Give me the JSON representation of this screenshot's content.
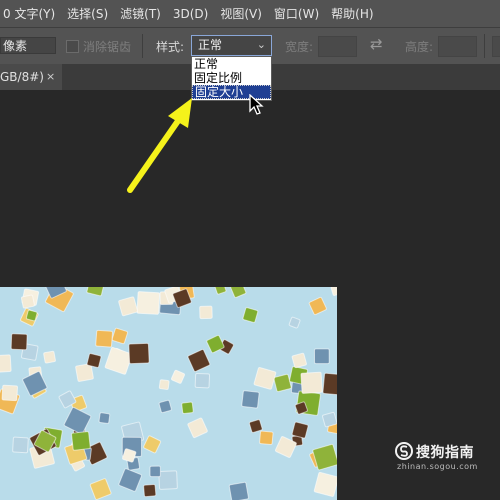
{
  "menubar": {
    "items": [
      "0 文字(Y)",
      "选择(S)",
      "滤镜(T)",
      "3D(D)",
      "视图(V)",
      "窗口(W)",
      "帮助(H)"
    ]
  },
  "options": {
    "feather_unit": "像素",
    "antialias_label": "消除锯齿",
    "style_label": "样式:",
    "style_value": "正常",
    "width_label": "宽度:",
    "width_value": "",
    "height_label": "高度:",
    "height_value": ""
  },
  "tab": {
    "title": "GB/8#)",
    "close": "×"
  },
  "style_dropdown": {
    "options": [
      "正常",
      "固定比例",
      "固定大小"
    ],
    "highlighted": "固定大小"
  },
  "watermark": {
    "text": "搜狗指南",
    "sub": "zhinan.sogou.com"
  },
  "colors": {
    "menubar_bg": "#535353",
    "workspace_bg": "#282828",
    "highlight": "#1f3f93",
    "arrow": "#f5f21b",
    "canvas_bg": "#b9dcea"
  }
}
